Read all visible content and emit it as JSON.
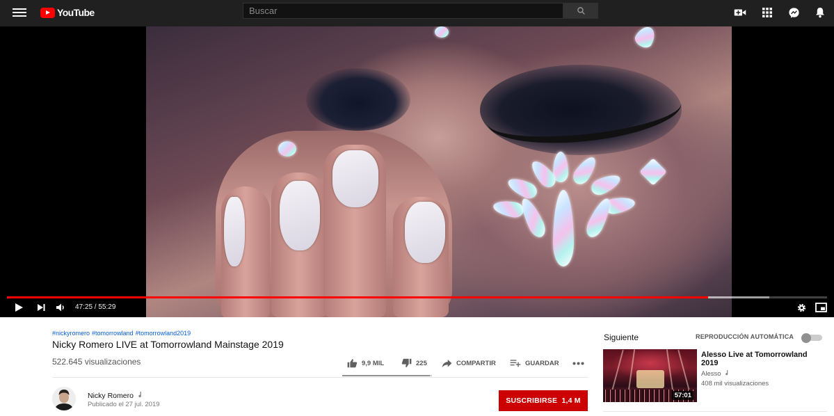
{
  "masthead": {
    "logo_text": "YouTube",
    "search_placeholder": "Buscar",
    "icons": [
      "menu-icon",
      "youtube-logo-icon",
      "search-icon",
      "create-video-icon",
      "apps-grid-icon",
      "messages-icon",
      "notifications-bell-icon"
    ]
  },
  "player": {
    "current_time": "47:25",
    "duration": "55:29",
    "time_display": "47:25 / 55:29",
    "played_fraction": 0.855,
    "loaded_fraction": 0.93,
    "icons": [
      "play-icon",
      "next-icon",
      "volume-icon",
      "settings-gear-icon",
      "miniplayer-icon"
    ],
    "accent_color": "#ff0000"
  },
  "video": {
    "hashtags": [
      "#nickyromero",
      "#tomorrowland",
      "#tomorrowland2019"
    ],
    "title": "Nicky Romero LIVE at Tomorrowland Mainstage 2019",
    "views": "522.645 visualizaciones",
    "likes": "9,9 MIL",
    "dislikes": "225",
    "like_fraction": 0.978,
    "share_label": "COMPARTIR",
    "save_label": "GUARDAR",
    "more_icon": "more-horizontal-icon"
  },
  "channel": {
    "name": "Nicky Romero",
    "verified_icon": "music-note-icon",
    "published": "Publicado el 27 jul. 2019",
    "subscribe_label": "SUSCRIBIRSE",
    "subscriber_count": "1,4 M",
    "subscribe_color": "#cc0000"
  },
  "sidebar": {
    "up_next_label": "Siguiente",
    "autoplay_label": "REPRODUCCIÓN AUTOMÁTICA",
    "autoplay_on": false,
    "related": [
      {
        "title": "Alesso Live at Tomorrowland 2019",
        "channel": "Alesso",
        "views": "408 mil visualizaciones",
        "duration": "57:01"
      }
    ]
  }
}
